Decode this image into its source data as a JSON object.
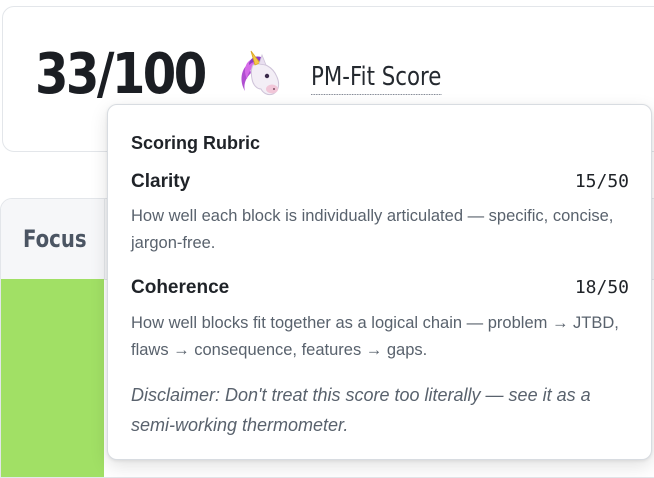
{
  "score": {
    "value": "33/100",
    "icon": "unicorn-icon",
    "label": "PM-Fit Score"
  },
  "table": {
    "focus_header": "Focus",
    "focus_color": "#a1e065"
  },
  "rubric": {
    "title": "Scoring Rubric",
    "criteria": [
      {
        "name": "Clarity",
        "score": "15/50",
        "description": "How well each block is individually articulated — specific, concise, jargon-free."
      },
      {
        "name": "Coherence",
        "score": "18/50",
        "description": "How well blocks fit together as a logical chain — problem → JTBD, flaws → consequence, features → gaps."
      }
    ],
    "disclaimer": "Disclaimer: Don't treat this score too literally — see it as a semi-working thermometer."
  }
}
